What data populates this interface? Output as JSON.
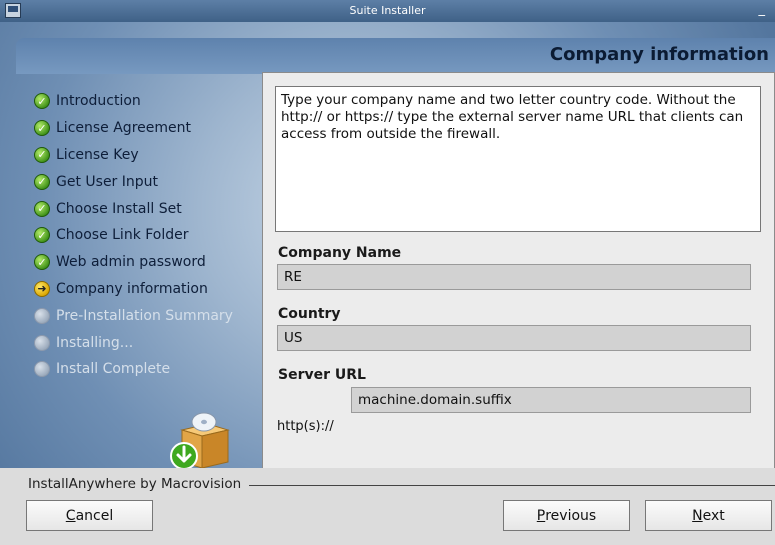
{
  "window": {
    "title": "Suite Installer",
    "minimize_glyph": "_"
  },
  "header": {
    "title": "Company information"
  },
  "steps": [
    {
      "label": "Introduction",
      "state": "done"
    },
    {
      "label": "License Agreement",
      "state": "done"
    },
    {
      "label": "License Key",
      "state": "done"
    },
    {
      "label": "Get User Input",
      "state": "done"
    },
    {
      "label": "Choose Install Set",
      "state": "done"
    },
    {
      "label": "Choose Link Folder",
      "state": "done"
    },
    {
      "label": "Web admin password",
      "state": "done"
    },
    {
      "label": "Company information",
      "state": "current"
    },
    {
      "label": "Pre-Installation Summary",
      "state": "pending"
    },
    {
      "label": "Installing...",
      "state": "pending"
    },
    {
      "label": "Install Complete",
      "state": "pending"
    }
  ],
  "description": "Type your company name and two letter country code. Without the http:// or https:// type the external server name URL that clients can access from outside the firewall.",
  "form": {
    "company_label": "Company Name",
    "company_value": "RE",
    "country_label": "Country",
    "country_value": "US",
    "server_label": "Server URL",
    "server_prefix": "http(s)://",
    "server_value": "machine.domain.suffix"
  },
  "footer": {
    "brand": "InstallAnywhere by Macrovision",
    "cancel": {
      "mnemonic": "C",
      "rest": "ancel"
    },
    "previous": {
      "mnemonic": "P",
      "rest": "revious"
    },
    "next": {
      "mnemonic": "N",
      "rest": "ext"
    }
  },
  "colors": {
    "done": "#3c8f16",
    "current": "#d9a400",
    "pending": "#9aa9bb"
  },
  "icons": {
    "done": "check-circle-icon",
    "current": "arrow-right-circle-icon",
    "pending": "empty-circle-icon"
  }
}
